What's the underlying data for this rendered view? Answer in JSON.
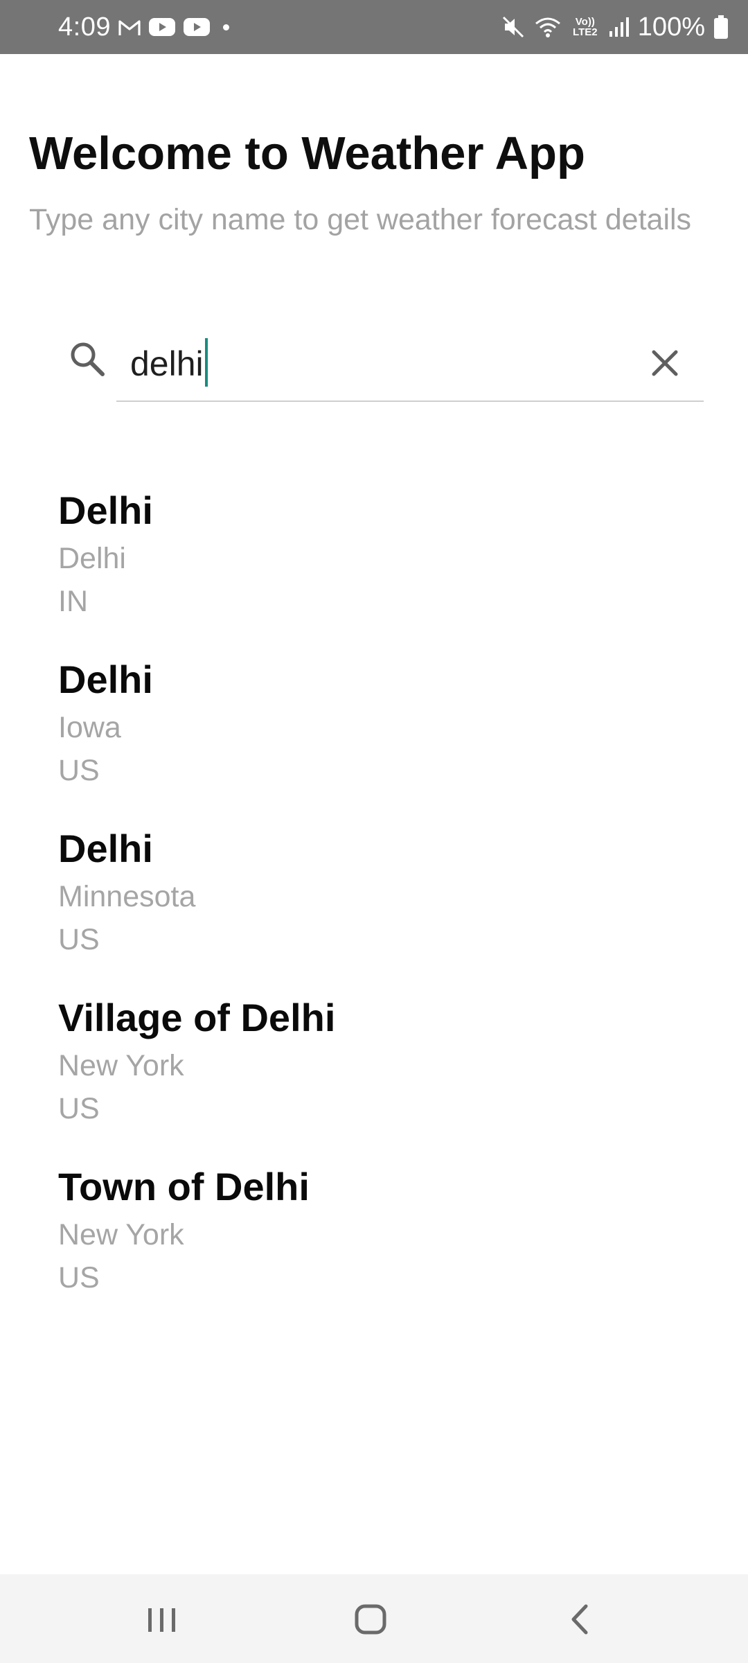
{
  "status_bar": {
    "time": "4:09",
    "battery": "100%",
    "network_label": "Vo)) LTE2",
    "icons": [
      "gmail-icon",
      "youtube-icon",
      "youtube-icon",
      "notification-dot",
      "mute-icon",
      "wifi-icon",
      "signal-icon",
      "battery-icon"
    ]
  },
  "header": {
    "title": "Welcome to Weather App",
    "subtitle": "Type any city name to get weather forecast details"
  },
  "search": {
    "value": "delhi",
    "icon": "search-icon",
    "clear_icon": "close-icon",
    "accent_color": "#1a8c7e"
  },
  "results": [
    {
      "city": "Delhi",
      "region": "Delhi",
      "country": "IN"
    },
    {
      "city": "Delhi",
      "region": "Iowa",
      "country": "US"
    },
    {
      "city": "Delhi",
      "region": "Minnesota",
      "country": "US"
    },
    {
      "city": "Village of Delhi",
      "region": "New York",
      "country": "US"
    },
    {
      "city": "Town of Delhi",
      "region": "New York",
      "country": "US"
    }
  ],
  "nav_bar": {
    "buttons": [
      "recent-apps-icon",
      "home-icon",
      "back-icon"
    ]
  }
}
